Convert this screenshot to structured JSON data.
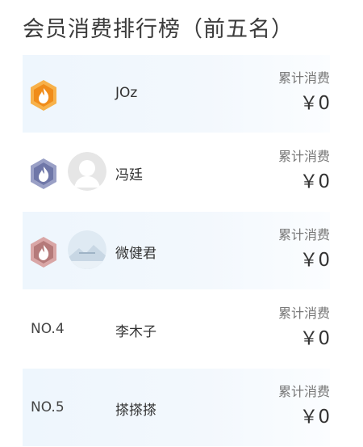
{
  "title": "会员消费排行榜（前五名）",
  "colors": {
    "gold": "#f5a623",
    "silver": "#6f77a8",
    "bronze": "#b57a7a",
    "row_shade": "#eef6fd"
  },
  "rows": [
    {
      "rank_badge": "gold-medal-icon",
      "name": "JOz",
      "stat_label": "累计消费",
      "stat_value": "￥0"
    },
    {
      "rank_badge": "silver-medal-icon",
      "name": "冯廷",
      "stat_label": "累计消费",
      "stat_value": "￥0"
    },
    {
      "rank_badge": "bronze-medal-icon",
      "name": "微健君",
      "stat_label": "累计消费",
      "stat_value": "￥0"
    },
    {
      "rank": "NO.4",
      "name": "李木子",
      "stat_label": "累计消费",
      "stat_value": "￥0"
    },
    {
      "rank": "NO.5",
      "name": "搽搽搽",
      "stat_label": "累计消费",
      "stat_value": "￥0"
    }
  ]
}
